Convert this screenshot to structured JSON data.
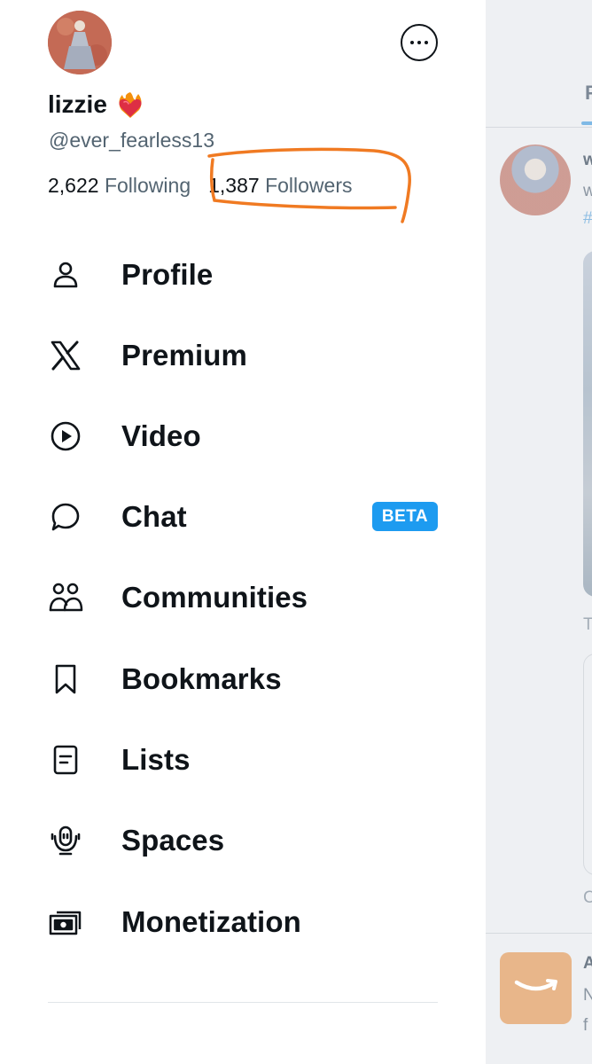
{
  "profile": {
    "display_name": "lizzie",
    "handle": "@ever_fearless13",
    "following_count": "2,622",
    "following_label": "Following",
    "followers_count": "1,387",
    "followers_label": "Followers"
  },
  "nav": {
    "items": [
      {
        "label": "Profile",
        "icon": "person-icon"
      },
      {
        "label": "Premium",
        "icon": "x-logo-icon"
      },
      {
        "label": "Video",
        "icon": "play-circle-icon"
      },
      {
        "label": "Chat",
        "icon": "chat-bubble-icon",
        "badge": "BETA"
      },
      {
        "label": "Communities",
        "icon": "communities-icon"
      },
      {
        "label": "Bookmarks",
        "icon": "bookmark-icon"
      },
      {
        "label": "Lists",
        "icon": "list-icon"
      },
      {
        "label": "Spaces",
        "icon": "spaces-microphone-icon"
      },
      {
        "label": "Monetization",
        "icon": "money-icon"
      }
    ]
  },
  "colors": {
    "text": "#0f1419",
    "secondary_text": "#536471",
    "accent": "#1d9bf0",
    "annotation": "#f07a22"
  }
}
